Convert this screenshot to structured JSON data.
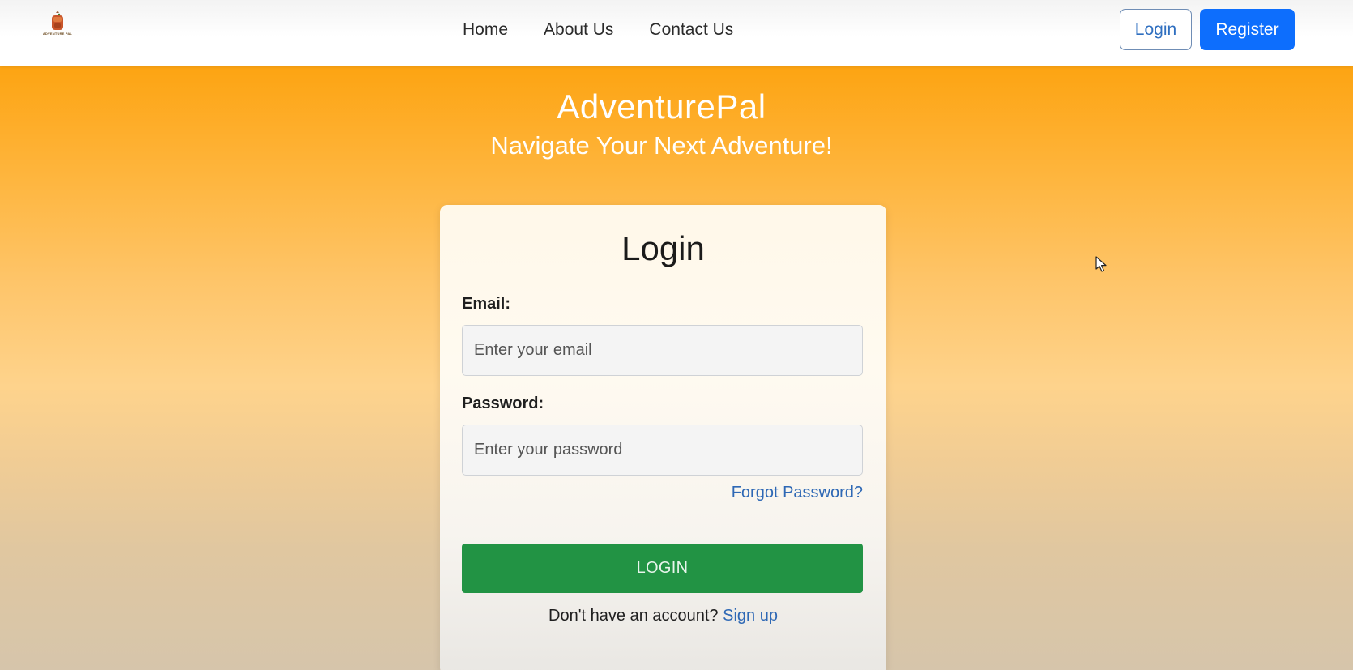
{
  "brand": {
    "logo_text": "ADVENTURE PAL",
    "logo_icon": "backpack-icon"
  },
  "nav": {
    "links": [
      "Home",
      "About Us",
      "Contact Us"
    ],
    "login_label": "Login",
    "register_label": "Register"
  },
  "hero": {
    "title": "AdventurePal",
    "subtitle": "Navigate Your Next Adventure!"
  },
  "login_form": {
    "title": "Login",
    "email_label": "Email:",
    "email_placeholder": "Enter your email",
    "email_value": "",
    "password_label": "Password:",
    "password_placeholder": "Enter your password",
    "password_value": "",
    "forgot_label": "Forgot Password?",
    "submit_label": "LOGIN",
    "signup_prompt": "Don't have an account?",
    "signup_link": "Sign up"
  },
  "colors": {
    "accent_blue": "#0d6efd",
    "submit_green": "#229344",
    "hero_orange": "#fda412",
    "link_blue": "#2e68b5"
  },
  "cursor_icon": "mouse-pointer-icon"
}
